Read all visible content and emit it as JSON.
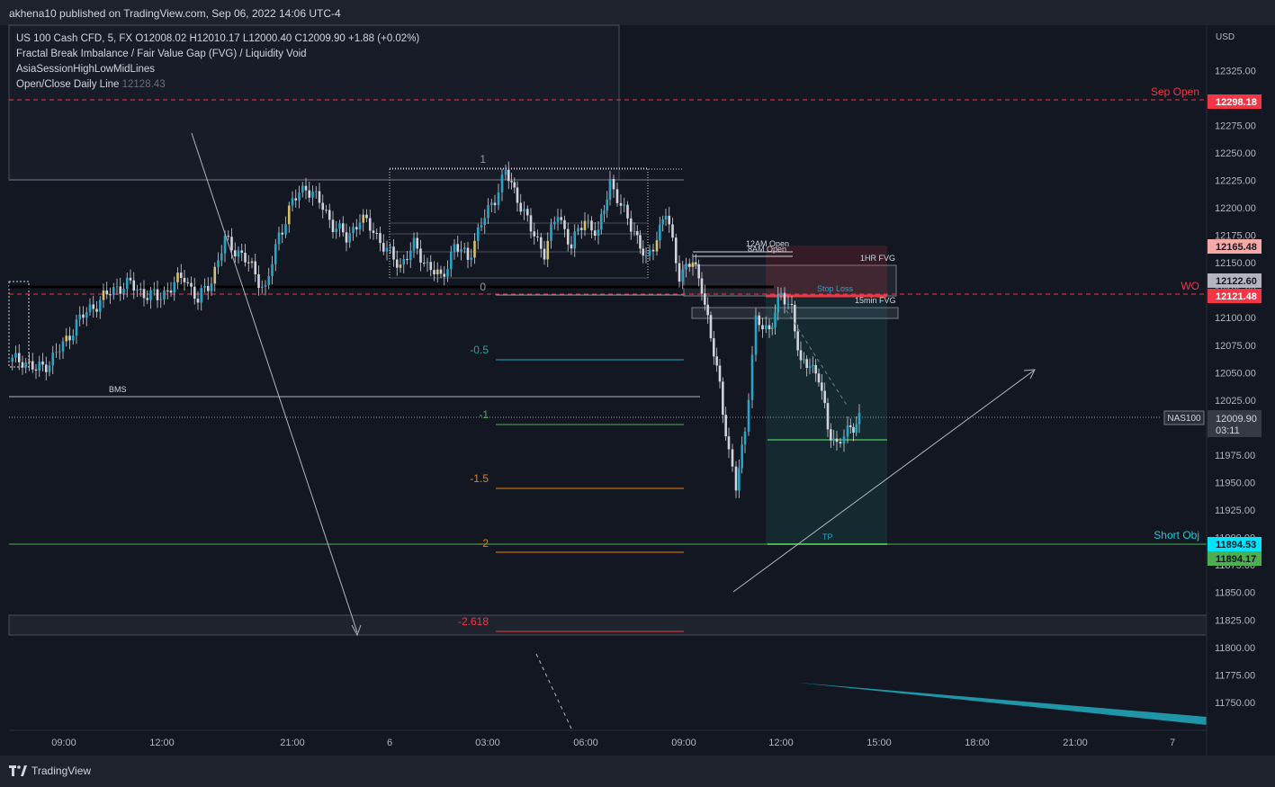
{
  "publisher": "akhena10 published on TradingView.com, Sep 06, 2022 14:06 UTC-4",
  "brand": "TradingView",
  "legend": {
    "symbol_line": "US 100 Cash CFD, 5, FX",
    "open": "O12008.02",
    "high": "H12010.17",
    "low": "L12000.40",
    "close": "C12009.90",
    "change": "+1.88 (+0.02%)",
    "indicators": [
      "Fractal Break Imbalance / Fair Value Gap (FVG) / Liquidity Void",
      "AsiaSessionHighLowMidLines",
      "Open/Close Daily Line"
    ],
    "daily_line_value": "12128.43"
  },
  "chart_data": {
    "type": "candlestick",
    "currency": "USD",
    "ylim": [
      11712,
      12358
    ],
    "y_ticks": [
      "12325.00",
      "12300.00",
      "12275.00",
      "12250.00",
      "12225.00",
      "12200.00",
      "12175.00",
      "12150.00",
      "12125.00",
      "12100.00",
      "12075.00",
      "12050.00",
      "12025.00",
      "12000.00",
      "11975.00",
      "11950.00",
      "11925.00",
      "11900.00",
      "11875.00",
      "11850.00",
      "11825.00",
      "11800.00",
      "11775.00",
      "11750.00"
    ],
    "x_ticks": [
      "09:00",
      "12:00",
      "21:00",
      "6",
      "03:00",
      "06:00",
      "09:00",
      "12:00",
      "15:00",
      "18:00",
      "21:00",
      "7"
    ],
    "price_labels": [
      {
        "text": "12298.18",
        "value": 12298.18,
        "color": "#f23645",
        "fg": "#ffffff"
      },
      {
        "text": "12165.48",
        "value": 12165.48,
        "color": "#f7a9a7",
        "fg": "#131722"
      },
      {
        "text": "12122.60",
        "value": 12122.6,
        "color": "#b2b5be",
        "fg": "#131722"
      },
      {
        "text": "12121.48",
        "value": 12121.48,
        "color": "#f23645",
        "fg": "#ffffff"
      },
      {
        "text": "11894.53",
        "value": 11894.53,
        "color": "#00e5ff",
        "fg": "#131722"
      },
      {
        "text": "11894.17",
        "value": 11894.17,
        "color": "#4caf50",
        "fg": "#131722"
      }
    ],
    "current_price": {
      "text": "12009.90",
      "value": 12009.9,
      "countdown": "03:11",
      "symbol": "NAS100"
    },
    "levels": {
      "sep_open": {
        "label": "Sep Open",
        "value": 12298.18,
        "color": "#f23645"
      },
      "wo": {
        "label": "WO",
        "value": 12121.48,
        "color": "#f23645"
      },
      "short_obj": {
        "label": "Short Obj",
        "value": 11894.53,
        "color": "#26c6da"
      },
      "bms": {
        "label": "BMS",
        "value": 12030
      }
    },
    "fib_labels": [
      {
        "text": "1",
        "value": 12238,
        "color": "#9598a1"
      },
      {
        "text": "0",
        "value": 12123,
        "color": "#9598a1"
      },
      {
        "text": "-0.5",
        "value": 12064,
        "color": "#26a69a"
      },
      {
        "text": "-1",
        "value": 12005,
        "color": "#4caf50"
      },
      {
        "text": "-1.5",
        "value": 11946,
        "color": "#f57c00"
      },
      {
        "text": "-2",
        "value": 11887,
        "color": "#f57c00"
      },
      {
        "text": "-2.618",
        "value": 11815,
        "color": "#f23645"
      }
    ],
    "annotations": {
      "open_12am": "12AM Open",
      "open_8am": "8AM Open",
      "fvg_1hr": "1HR FVG",
      "fvg_15min": "15min FVG",
      "stop_loss": "Stop Loss",
      "tp": "TP"
    },
    "up_color": "#26a6c6",
    "down_color": "#26a6c6",
    "accent_color": "#d4c26a",
    "path": [
      [
        0,
        12060
      ],
      [
        15,
        12062
      ],
      [
        30,
        12052
      ],
      [
        45,
        12060
      ],
      [
        60,
        12075
      ],
      [
        75,
        12095
      ],
      [
        90,
        12108
      ],
      [
        105,
        12118
      ],
      [
        120,
        12128
      ],
      [
        135,
        12130
      ],
      [
        150,
        12122
      ],
      [
        165,
        12118
      ],
      [
        180,
        12128
      ],
      [
        195,
        12138
      ],
      [
        210,
        12115
      ],
      [
        225,
        12135
      ],
      [
        240,
        12170
      ],
      [
        255,
        12160
      ],
      [
        270,
        12145
      ],
      [
        285,
        12125
      ],
      [
        300,
        12175
      ],
      [
        315,
        12205
      ],
      [
        330,
        12220
      ],
      [
        345,
        12205
      ],
      [
        360,
        12185
      ],
      [
        375,
        12172
      ],
      [
        390,
        12190
      ],
      [
        405,
        12180
      ],
      [
        420,
        12160
      ],
      [
        435,
        12148
      ],
      [
        450,
        12165
      ],
      [
        465,
        12148
      ],
      [
        480,
        12135
      ],
      [
        495,
        12165
      ],
      [
        510,
        12155
      ],
      [
        525,
        12185
      ],
      [
        540,
        12210
      ],
      [
        552,
        12232
      ],
      [
        565,
        12210
      ],
      [
        580,
        12180
      ],
      [
        595,
        12160
      ],
      [
        610,
        12195
      ],
      [
        625,
        12165
      ],
      [
        640,
        12190
      ],
      [
        655,
        12175
      ],
      [
        668,
        12225
      ],
      [
        680,
        12200
      ],
      [
        695,
        12180
      ],
      [
        708,
        12150
      ],
      [
        720,
        12175
      ],
      [
        730,
        12195
      ],
      [
        745,
        12140
      ],
      [
        760,
        12150
      ],
      [
        770,
        12130
      ],
      [
        780,
        12080
      ],
      [
        790,
        12040
      ],
      [
        800,
        11975
      ],
      [
        808,
        11945
      ],
      [
        818,
        12000
      ],
      [
        830,
        12095
      ],
      [
        845,
        12090
      ],
      [
        858,
        12120
      ],
      [
        870,
        12110
      ],
      [
        880,
        12055
      ],
      [
        890,
        12060
      ],
      [
        900,
        12045
      ],
      [
        910,
        12000
      ],
      [
        920,
        11985
      ],
      [
        932,
        11995
      ],
      [
        945,
        12010
      ]
    ]
  }
}
